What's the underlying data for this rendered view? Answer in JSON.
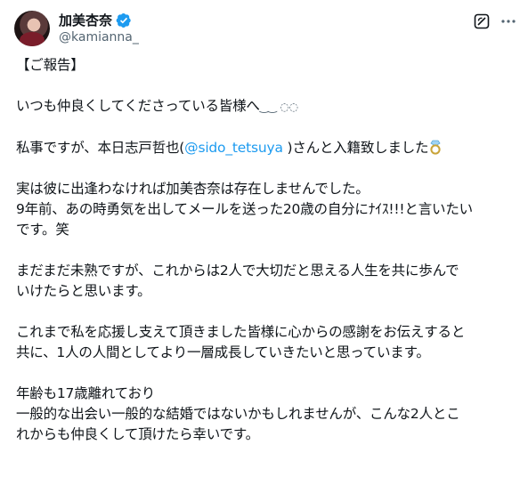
{
  "user": {
    "display_name": "加美杏奈",
    "handle": "@kamianna_"
  },
  "tweet": {
    "p1": "【ご報告】",
    "p2": "いつも仲良くしてくださっている皆様へ",
    "p2_deco": "‿‿ ◌◌",
    "p3_pre": "私事ですが、本日志戸哲也(",
    "p3_mention": "@sido_tetsuya",
    "p3_post": " )さんと入籍致しました",
    "p4_l1": "実は彼に出逢わなければ加美杏奈は存在しませんでした。",
    "p4_l2": "9年前、あの時勇気を出してメールを送った20歳の自分にﾅｲｽ!!!と言いたい",
    "p4_l3": "です。笑",
    "p5_l1": "まだまだ未熟ですが、これからは2人で大切だと思える人生を共に歩んで",
    "p5_l2": "いけたらと思います。",
    "p6_l1": "これまで私を応援し支えて頂きました皆様に心からの感謝をお伝えすると",
    "p6_l2": "共に、1人の人間としてより一層成長していきたいと思っています。",
    "p7_l1": "年齢も17歳離れており",
    "p7_l2": "一般的な出会い一般的な結婚ではないかもしれませんが、こんな2人とこ",
    "p7_l3": "れからも仲良くして頂けたら幸いです。"
  },
  "icons": {
    "verified": "verified-badge-icon",
    "grok": "grok-icon",
    "more": "more-icon",
    "ring": "ring-emoji-icon"
  },
  "colors": {
    "accent": "#1d9bf0",
    "text": "#0f1419",
    "secondary": "#536471"
  }
}
